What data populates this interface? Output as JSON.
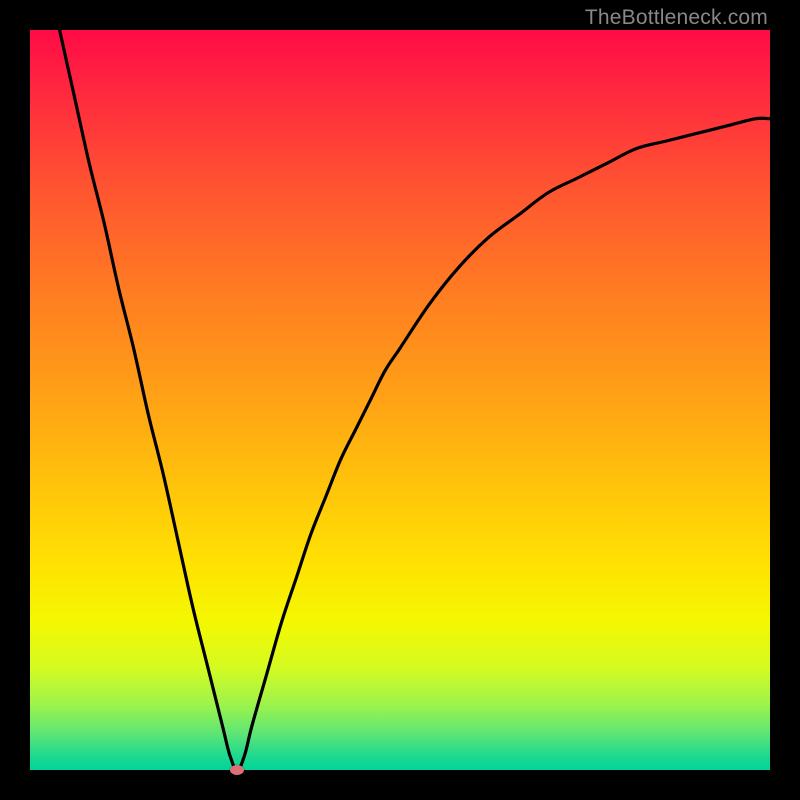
{
  "watermark": "TheBottleneck.com",
  "chart_data": {
    "type": "line",
    "title": "",
    "xlabel": "",
    "ylabel": "",
    "xlim": [
      0,
      100
    ],
    "ylim": [
      0,
      100
    ],
    "grid": false,
    "series": [
      {
        "name": "curve",
        "x": [
          4,
          6,
          8,
          10,
          12,
          14,
          16,
          18,
          20,
          22,
          24,
          26,
          27,
          28,
          29,
          30,
          32,
          34,
          36,
          38,
          40,
          42,
          44,
          46,
          48,
          50,
          54,
          58,
          62,
          66,
          70,
          74,
          78,
          82,
          86,
          90,
          94,
          98,
          100
        ],
        "y": [
          100,
          91,
          82,
          74,
          65,
          57,
          48,
          40,
          31,
          22,
          14,
          6,
          2,
          0,
          2,
          6,
          13,
          20,
          26,
          32,
          37,
          42,
          46,
          50,
          54,
          57,
          63,
          68,
          72,
          75,
          78,
          80,
          82,
          84,
          85,
          86,
          87,
          88,
          88
        ]
      }
    ],
    "marker": {
      "x": 28,
      "y": 0,
      "color": "#dd6f77"
    }
  }
}
